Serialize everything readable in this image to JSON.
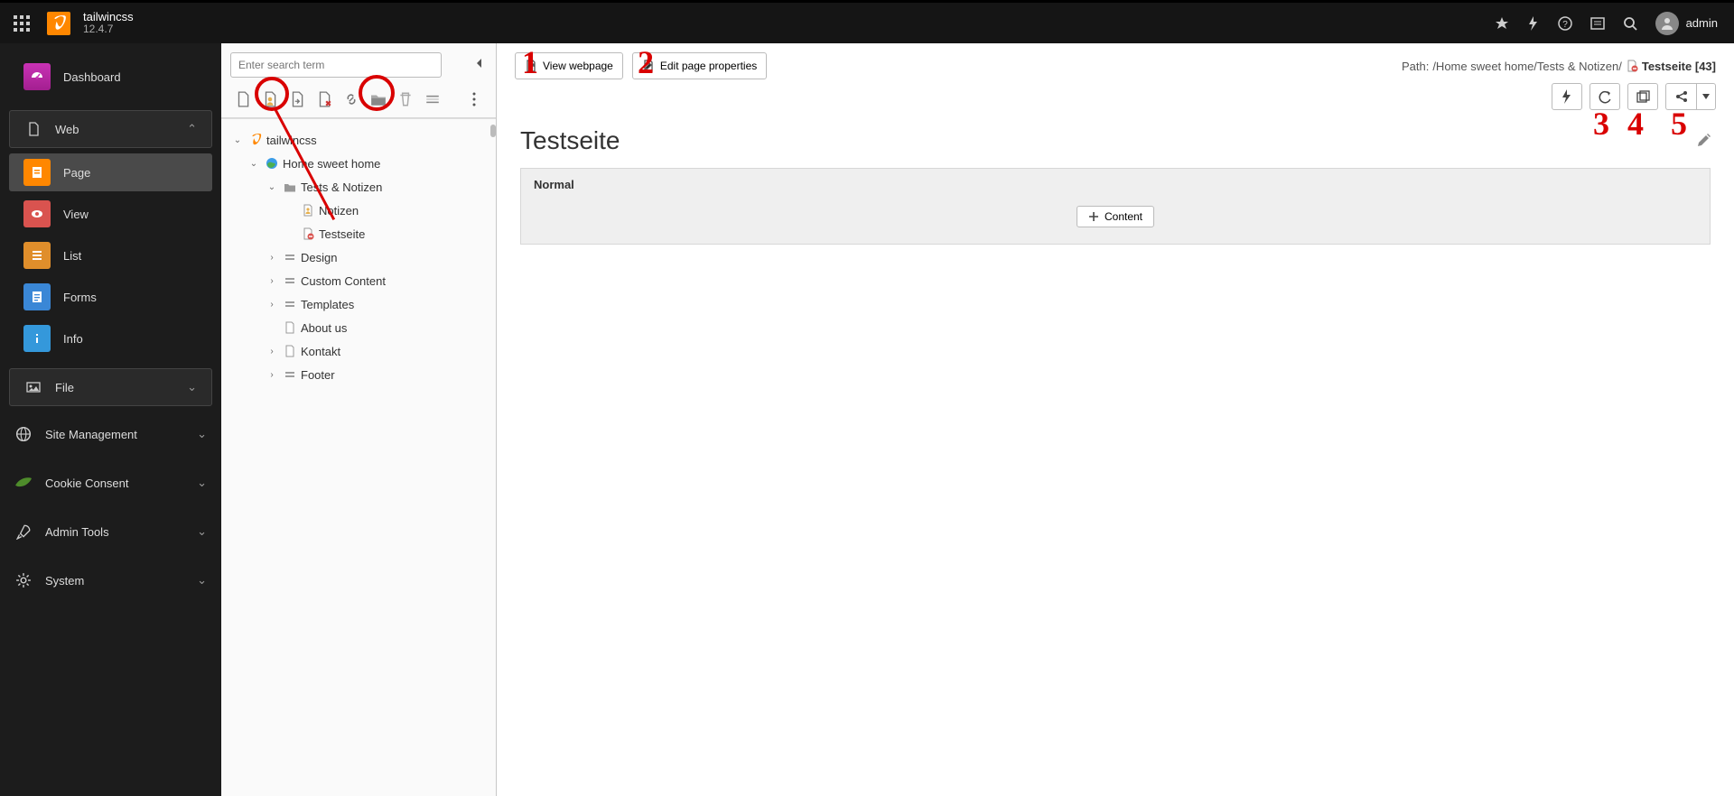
{
  "topbar": {
    "site_name": "tailwincss",
    "version": "12.4.7",
    "user": "admin"
  },
  "modules": {
    "dashboard": "Dashboard",
    "web": "Web",
    "web_items": [
      "Page",
      "View",
      "List",
      "Forms",
      "Info"
    ],
    "file": "File",
    "site_management": "Site Management",
    "cookie_consent": "Cookie Consent",
    "admin_tools": "Admin Tools",
    "system": "System"
  },
  "pagetree": {
    "search_placeholder": "Enter search term",
    "root": "tailwincss",
    "root_children": [
      {
        "label": "Home sweet home",
        "icon": "globe",
        "expanded": true,
        "children": [
          {
            "label": "Tests & Notizen",
            "icon": "folder",
            "expanded": true,
            "children": [
              {
                "label": "Notizen",
                "icon": "doc"
              },
              {
                "label": "Testseite",
                "icon": "doc-hidden"
              }
            ]
          },
          {
            "label": "Design",
            "icon": "divider",
            "has_children": true
          },
          {
            "label": "Custom Content",
            "icon": "divider",
            "has_children": true
          },
          {
            "label": "Templates",
            "icon": "divider",
            "has_children": true
          },
          {
            "label": "About us",
            "icon": "doc"
          },
          {
            "label": "Kontakt",
            "icon": "doc",
            "has_children": true
          },
          {
            "label": "Footer",
            "icon": "divider",
            "has_children": true
          }
        ]
      }
    ]
  },
  "content": {
    "view_webpage": "View webpage",
    "edit_props": "Edit page properties",
    "path_label": "Path:",
    "path_value": "/Home sweet home/Tests & Notizen/",
    "page_name": "Testseite",
    "page_uid": "[43]",
    "page_title": "Testseite",
    "colpos_label": "Normal",
    "add_content": "Content"
  },
  "annotations": {
    "n1": "1",
    "n2": "2",
    "n3": "3",
    "n4": "4",
    "n5": "5"
  }
}
